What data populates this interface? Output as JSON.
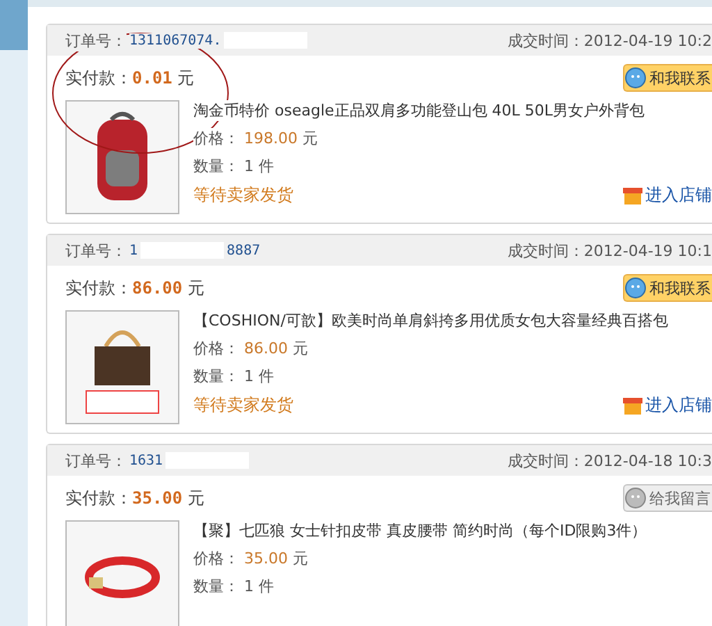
{
  "orders": [
    {
      "order_label": "订单号：",
      "order_number": [
        "1311067074."
      ],
      "time": "成交时间：2012-04-19 10:2",
      "paid_label": "实付款：",
      "paid": "0.01",
      "unit": "元",
      "contact": {
        "kind": "online",
        "label": "和我联系"
      },
      "title": "淘金币特价 oseagle正品双肩多功能登山包 40L 50L男女户外背包",
      "price_label": "价格：",
      "price": "198.00",
      "price_unit": "元",
      "qty_label": "数量：",
      "qty": "1 件",
      "status": "等待卖家发货",
      "store": "进入店铺",
      "annotated": true
    },
    {
      "order_label": "订单号：",
      "order_number": [
        "1",
        "8887"
      ],
      "time": "成交时间：2012-04-19 10:1",
      "paid_label": "实付款：",
      "paid": "86.00",
      "unit": "元",
      "contact": {
        "kind": "online",
        "label": "和我联系"
      },
      "title": "【COSHION/可歆】欧美时尚单肩斜挎多用优质女包大容量经典百搭包",
      "price_label": "价格：",
      "price": "86.00",
      "price_unit": "元",
      "qty_label": "数量：",
      "qty": "1 件",
      "status": "等待卖家发货",
      "store": "进入店铺",
      "annotated": false
    },
    {
      "order_label": "订单号：",
      "order_number": [
        "1631"
      ],
      "time": "成交时间：2012-04-18 10:3",
      "paid_label": "实付款：",
      "paid": "35.00",
      "unit": "元",
      "contact": {
        "kind": "offline",
        "label": "给我留言"
      },
      "title": "【聚】七匹狼 女士针扣皮带 真皮腰带 简约时尚（每个ID限购3件）",
      "price_label": "价格：",
      "price": "35.00",
      "price_unit": "元",
      "qty_label": "数量：",
      "qty": "1 件",
      "annotated": false
    }
  ]
}
